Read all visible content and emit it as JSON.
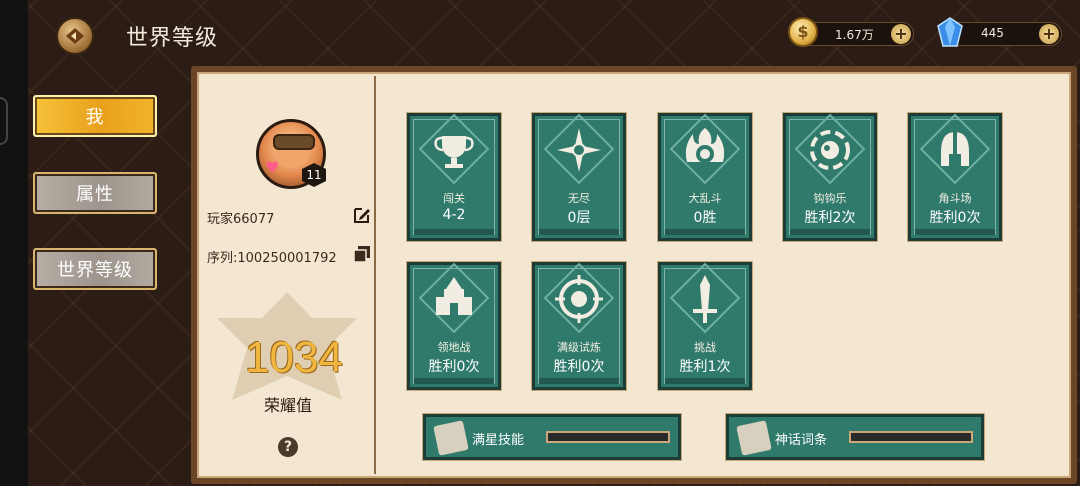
{
  "header": {
    "title": "世界等级",
    "gold": "1.67万",
    "gems": "445",
    "plus": "+"
  },
  "tabs": [
    {
      "label": "我",
      "active": true
    },
    {
      "label": "属性",
      "active": false
    },
    {
      "label": "世界等级",
      "active": false
    }
  ],
  "profile": {
    "level": "11",
    "name": "玩家66077",
    "serial": "序列:100250001792",
    "honor_value": "1034",
    "honor_label": "荣耀值",
    "help": "?"
  },
  "modes": [
    {
      "name": "闯关",
      "stat": "4-2",
      "icon": "trophy-icon"
    },
    {
      "name": "无尽",
      "stat": "0层",
      "icon": "star-compass-icon"
    },
    {
      "name": "大乱斗",
      "stat": "0胜",
      "icon": "flame-mask-icon"
    },
    {
      "name": "钩钩乐",
      "stat": "胜利2次",
      "icon": "swirl-icon"
    },
    {
      "name": "角斗场",
      "stat": "胜利0次",
      "icon": "helmet-icon"
    },
    {
      "name": "领地战",
      "stat": "胜利0次",
      "icon": "castle-icon"
    },
    {
      "name": "满级试炼",
      "stat": "胜利0次",
      "icon": "target-icon"
    },
    {
      "name": "挑战",
      "stat": "胜利1次",
      "icon": "sword-icon"
    }
  ],
  "bottom": [
    {
      "label": "满星技能",
      "progress": 0
    },
    {
      "label": "神话词条",
      "progress": 0
    }
  ]
}
